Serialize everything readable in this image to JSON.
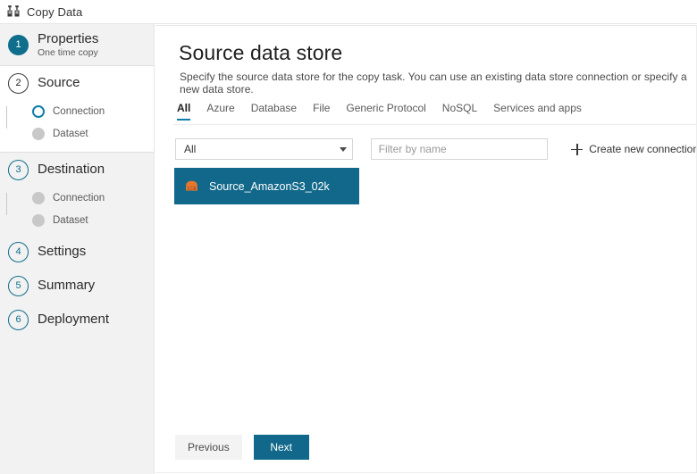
{
  "window": {
    "title": "Copy Data",
    "icon": "copy-data-icon"
  },
  "sidebar": {
    "steps": [
      {
        "number": "1",
        "title": "Properties",
        "subtitle": "One time copy",
        "state": "completed",
        "substeps": []
      },
      {
        "number": "2",
        "title": "Source",
        "subtitle": "",
        "state": "active",
        "substeps": [
          {
            "label": "Connection",
            "state": "current"
          },
          {
            "label": "Dataset",
            "state": "pending"
          }
        ]
      },
      {
        "number": "3",
        "title": "Destination",
        "subtitle": "",
        "state": "pending",
        "substeps": [
          {
            "label": "Connection",
            "state": "pending"
          },
          {
            "label": "Dataset",
            "state": "pending"
          }
        ]
      },
      {
        "number": "4",
        "title": "Settings",
        "subtitle": "",
        "state": "pending",
        "substeps": []
      },
      {
        "number": "5",
        "title": "Summary",
        "subtitle": "",
        "state": "pending",
        "substeps": []
      },
      {
        "number": "6",
        "title": "Deployment",
        "subtitle": "",
        "state": "pending",
        "substeps": []
      }
    ]
  },
  "main": {
    "title": "Source data store",
    "description": "Specify the source data store for the copy task. You can use an existing data store connection or specify a new data store.",
    "tabs": [
      {
        "label": "All",
        "active": true
      },
      {
        "label": "Azure",
        "active": false
      },
      {
        "label": "Database",
        "active": false
      },
      {
        "label": "File",
        "active": false
      },
      {
        "label": "Generic Protocol",
        "active": false
      },
      {
        "label": "NoSQL",
        "active": false
      },
      {
        "label": "Services and apps",
        "active": false
      }
    ],
    "filters": {
      "type_select_value": "All",
      "type_select_options": [
        "All"
      ],
      "name_filter_value": "",
      "name_filter_placeholder": "Filter by name",
      "create_new_label": "Create new connection"
    },
    "connections": [
      {
        "name": "Source_AmazonS3_02k",
        "icon": "amazon-s3-icon",
        "selected": true
      }
    ],
    "footer": {
      "previous_label": "Previous",
      "next_label": "Next"
    }
  },
  "colors": {
    "accent": "#11688a",
    "accent_light": "#0f7ea8",
    "tile_selected": "#11688a",
    "sidebar_bg": "#f2f2f2",
    "s3_orange": "#e8762d"
  }
}
